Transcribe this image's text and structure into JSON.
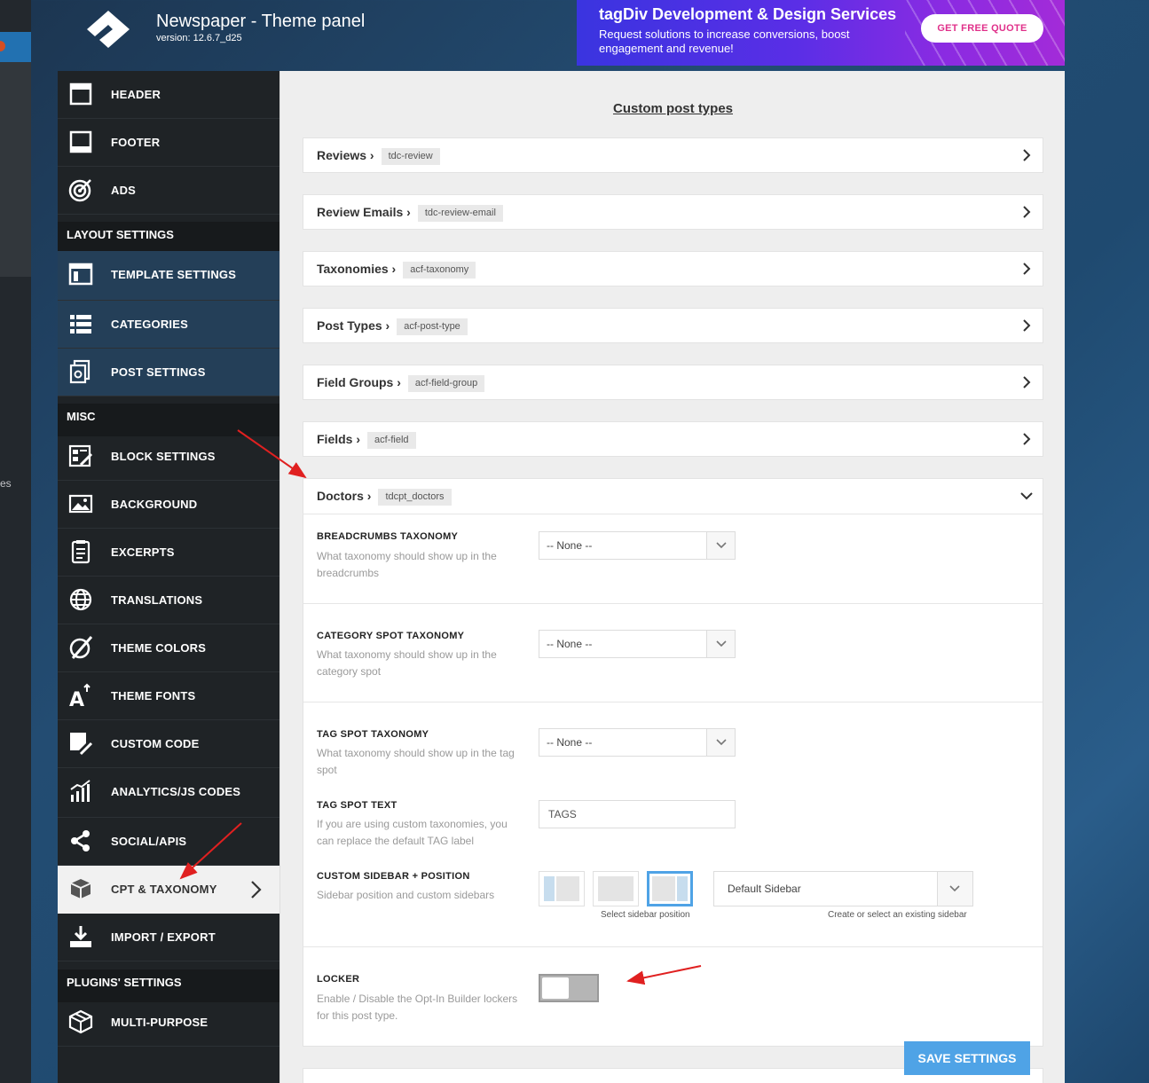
{
  "app": {
    "title": "Newspaper - Theme panel",
    "version": "version: 12.6.7_d25"
  },
  "wp_fragment": "es",
  "banner": {
    "title": "tagDiv Development & Design Services",
    "desc": "Request solutions to increase conversions, boost engagement and revenue!",
    "button": "GET FREE QUOTE"
  },
  "sidebar": {
    "items_top": [
      {
        "label": "HEADER",
        "icon": "header-icon"
      },
      {
        "label": "FOOTER",
        "icon": "footer-icon"
      },
      {
        "label": "ADS",
        "icon": "target-icon"
      }
    ],
    "section_layout": "LAYOUT SETTINGS",
    "items_layout": [
      {
        "label": "TEMPLATE SETTINGS",
        "icon": "template-icon"
      },
      {
        "label": "CATEGORIES",
        "icon": "list-icon"
      },
      {
        "label": "POST SETTINGS",
        "icon": "post-settings-icon"
      }
    ],
    "section_misc": "MISC",
    "items_misc": [
      {
        "label": "BLOCK SETTINGS",
        "icon": "block-icon"
      },
      {
        "label": "BACKGROUND",
        "icon": "image-icon"
      },
      {
        "label": "EXCERPTS",
        "icon": "document-icon"
      },
      {
        "label": "TRANSLATIONS",
        "icon": "globe-icon"
      },
      {
        "label": "THEME COLORS",
        "icon": "palette-icon"
      },
      {
        "label": "THEME FONTS",
        "icon": "font-icon"
      },
      {
        "label": "CUSTOM CODE",
        "icon": "code-icon"
      },
      {
        "label": "ANALYTICS/JS CODES",
        "icon": "analytics-icon"
      },
      {
        "label": "SOCIAL/APIS",
        "icon": "share-icon"
      },
      {
        "label": "CPT & TAXONOMY",
        "icon": "cube-icon",
        "active": true
      },
      {
        "label": "IMPORT / EXPORT",
        "icon": "download-icon"
      }
    ],
    "section_plugins": "PLUGINS' SETTINGS",
    "items_plugins": [
      {
        "label": "MULTI-PURPOSE",
        "icon": "box-icon"
      }
    ]
  },
  "main": {
    "title": "Custom post types",
    "panels": [
      {
        "title": "Reviews",
        "tag": "tdc-review"
      },
      {
        "title": "Review Emails",
        "tag": "tdc-review-email"
      },
      {
        "title": "Taxonomies",
        "tag": "acf-taxonomy"
      },
      {
        "title": "Post Types",
        "tag": "acf-post-type"
      },
      {
        "title": "Field Groups",
        "tag": "acf-field-group"
      },
      {
        "title": "Fields",
        "tag": "acf-field"
      },
      {
        "title": "Doctors",
        "tag": "tdcpt_doctors"
      }
    ],
    "options": {
      "breadcrumbs": {
        "title": "BREADCRUMBS TAXONOMY",
        "desc": "What taxonomy should show up in the breadcrumbs",
        "value": "-- None --"
      },
      "category_spot": {
        "title": "CATEGORY SPOT TAXONOMY",
        "desc": "What taxonomy should show up in the category spot",
        "value": "-- None --"
      },
      "tag_spot": {
        "title": "TAG SPOT TAXONOMY",
        "desc": "What taxonomy should show up in the tag spot",
        "value": "-- None --"
      },
      "tag_text": {
        "title": "TAG SPOT TEXT",
        "desc": "If you are using custom taxonomies, you can replace the default TAG label",
        "placeholder": "TAGS"
      },
      "sidebar": {
        "title": "CUSTOM SIDEBAR + POSITION",
        "desc": "Sidebar position and custom sidebars",
        "position_caption": "Select sidebar position",
        "select_value": "Default Sidebar",
        "select_caption": "Create or select an existing sidebar"
      },
      "locker": {
        "title": "LOCKER",
        "desc": "Enable / Disable the Opt-In Builder lockers for this post type.",
        "enabled": false
      }
    },
    "save_button": "SAVE SETTINGS"
  },
  "colors": {
    "accent": "#4fa3e6",
    "sidebar_bg": "#1f2326",
    "annotation": "#e02020"
  }
}
